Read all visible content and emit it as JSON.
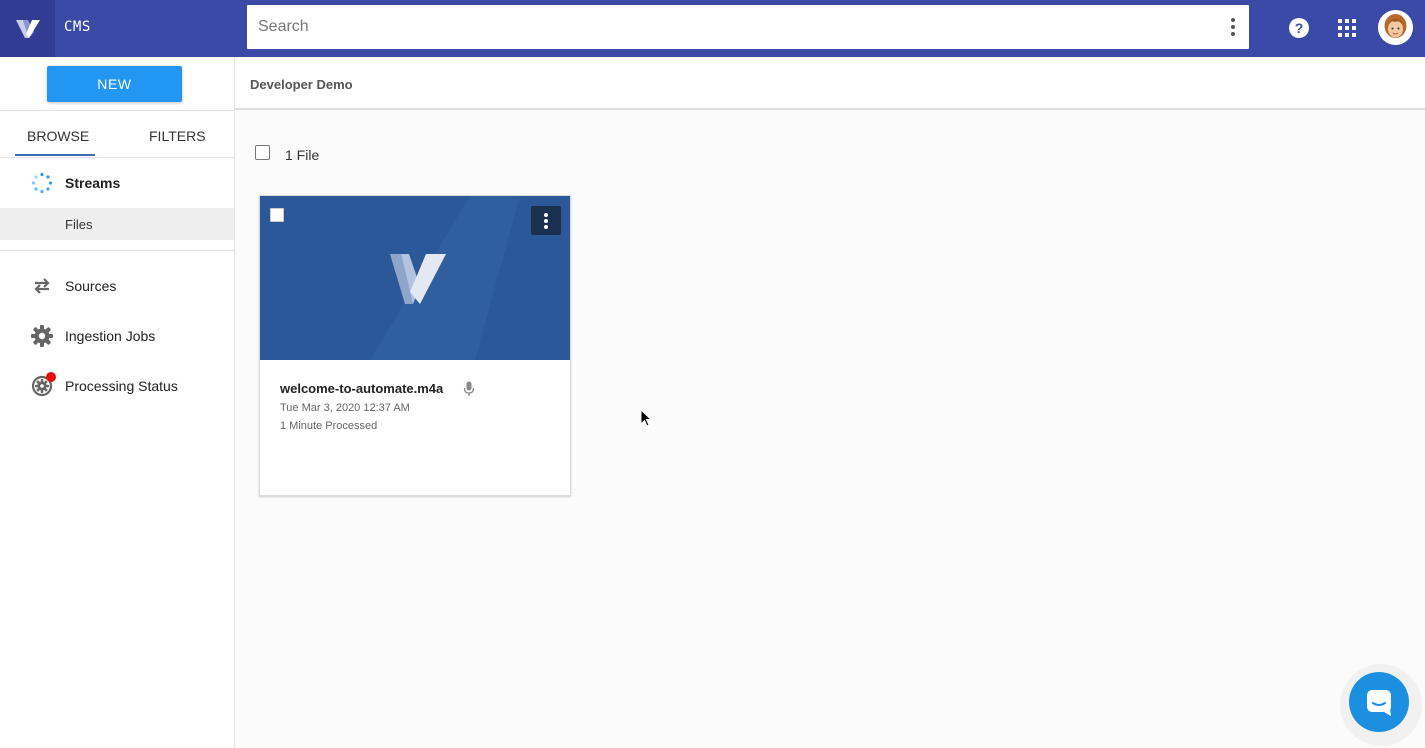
{
  "app": {
    "name": "CMS"
  },
  "search": {
    "placeholder": "Search"
  },
  "sidebar": {
    "new_label": "NEW",
    "tabs": [
      {
        "label": "BROWSE",
        "active": true
      },
      {
        "label": "FILTERS",
        "active": false
      }
    ],
    "items": [
      {
        "label": "Streams",
        "icon": "spinner-dots-icon"
      },
      {
        "label": "Files",
        "icon": ""
      },
      {
        "label": "Sources",
        "icon": "swap-arrows-icon"
      },
      {
        "label": "Ingestion Jobs",
        "icon": "gear-icon"
      },
      {
        "label": "Processing Status",
        "icon": "gear-refresh-icon",
        "badge": true
      }
    ]
  },
  "header": {
    "title": "Developer Demo"
  },
  "content": {
    "count_label": "1 File",
    "files": [
      {
        "name": "welcome-to-automate.m4a",
        "date": "Tue Mar 3, 2020 12:37 AM",
        "processed": "1 Minute Processed",
        "type_icon": "microphone-icon"
      }
    ]
  },
  "colors": {
    "topbar": "#3b4aa6",
    "accent": "#2196f3",
    "thumbnail": "#2a5899",
    "badge": "#e50d0d",
    "chat": "#1d8fe0"
  }
}
